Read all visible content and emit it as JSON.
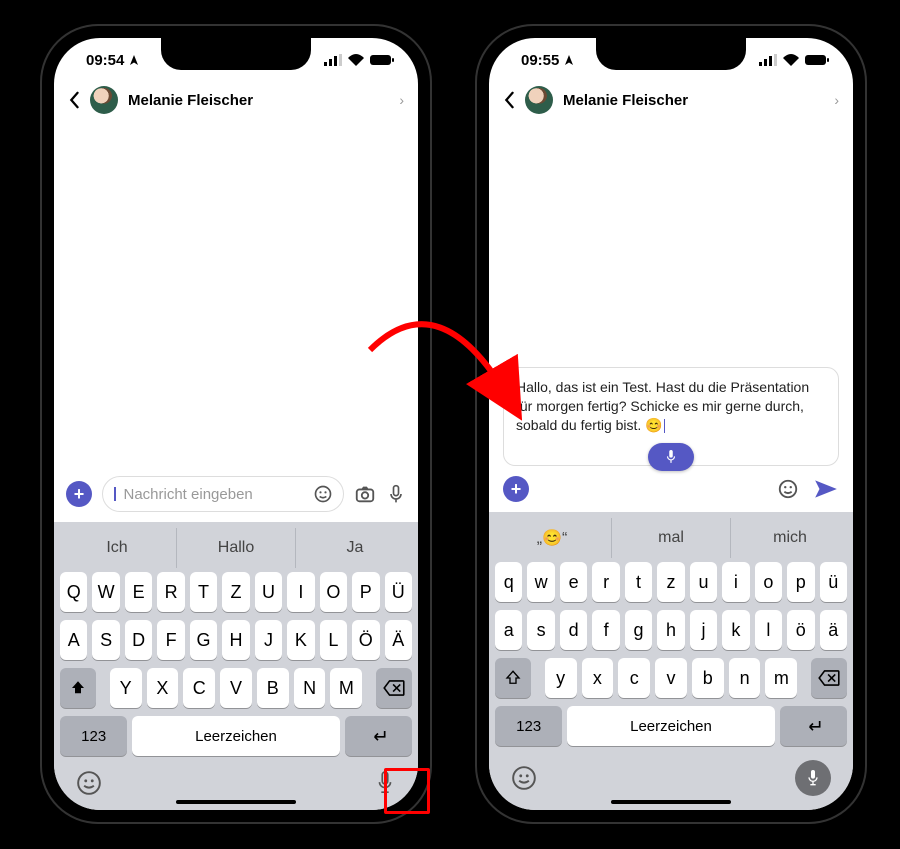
{
  "left": {
    "time": "09:54",
    "contact": "Melanie Fleischer",
    "placeholder": "Nachricht eingeben",
    "suggestions": [
      "Ich",
      "Hallo",
      "Ja"
    ],
    "row1": [
      "Q",
      "W",
      "E",
      "R",
      "T",
      "Z",
      "U",
      "I",
      "O",
      "P",
      "Ü"
    ],
    "row2": [
      "A",
      "S",
      "D",
      "F",
      "G",
      "H",
      "J",
      "K",
      "L",
      "Ö",
      "Ä"
    ],
    "row3": [
      "Y",
      "X",
      "C",
      "V",
      "B",
      "N",
      "M"
    ],
    "num_key": "123",
    "space_key": "Leerzeichen"
  },
  "right": {
    "time": "09:55",
    "contact": "Melanie Fleischer",
    "draft": "Hallo, das ist ein Test. Hast du die Präsentation für morgen fertig? Schicke es mir gerne durch, sobald du fertig bist. 😊",
    "suggestions": [
      "„😊“",
      "mal",
      "mich"
    ],
    "row1": [
      "q",
      "w",
      "e",
      "r",
      "t",
      "z",
      "u",
      "i",
      "o",
      "p",
      "ü"
    ],
    "row2": [
      "a",
      "s",
      "d",
      "f",
      "g",
      "h",
      "j",
      "k",
      "l",
      "ö",
      "ä"
    ],
    "row3": [
      "y",
      "x",
      "c",
      "v",
      "b",
      "n",
      "m"
    ],
    "num_key": "123",
    "space_key": "Leerzeichen"
  }
}
